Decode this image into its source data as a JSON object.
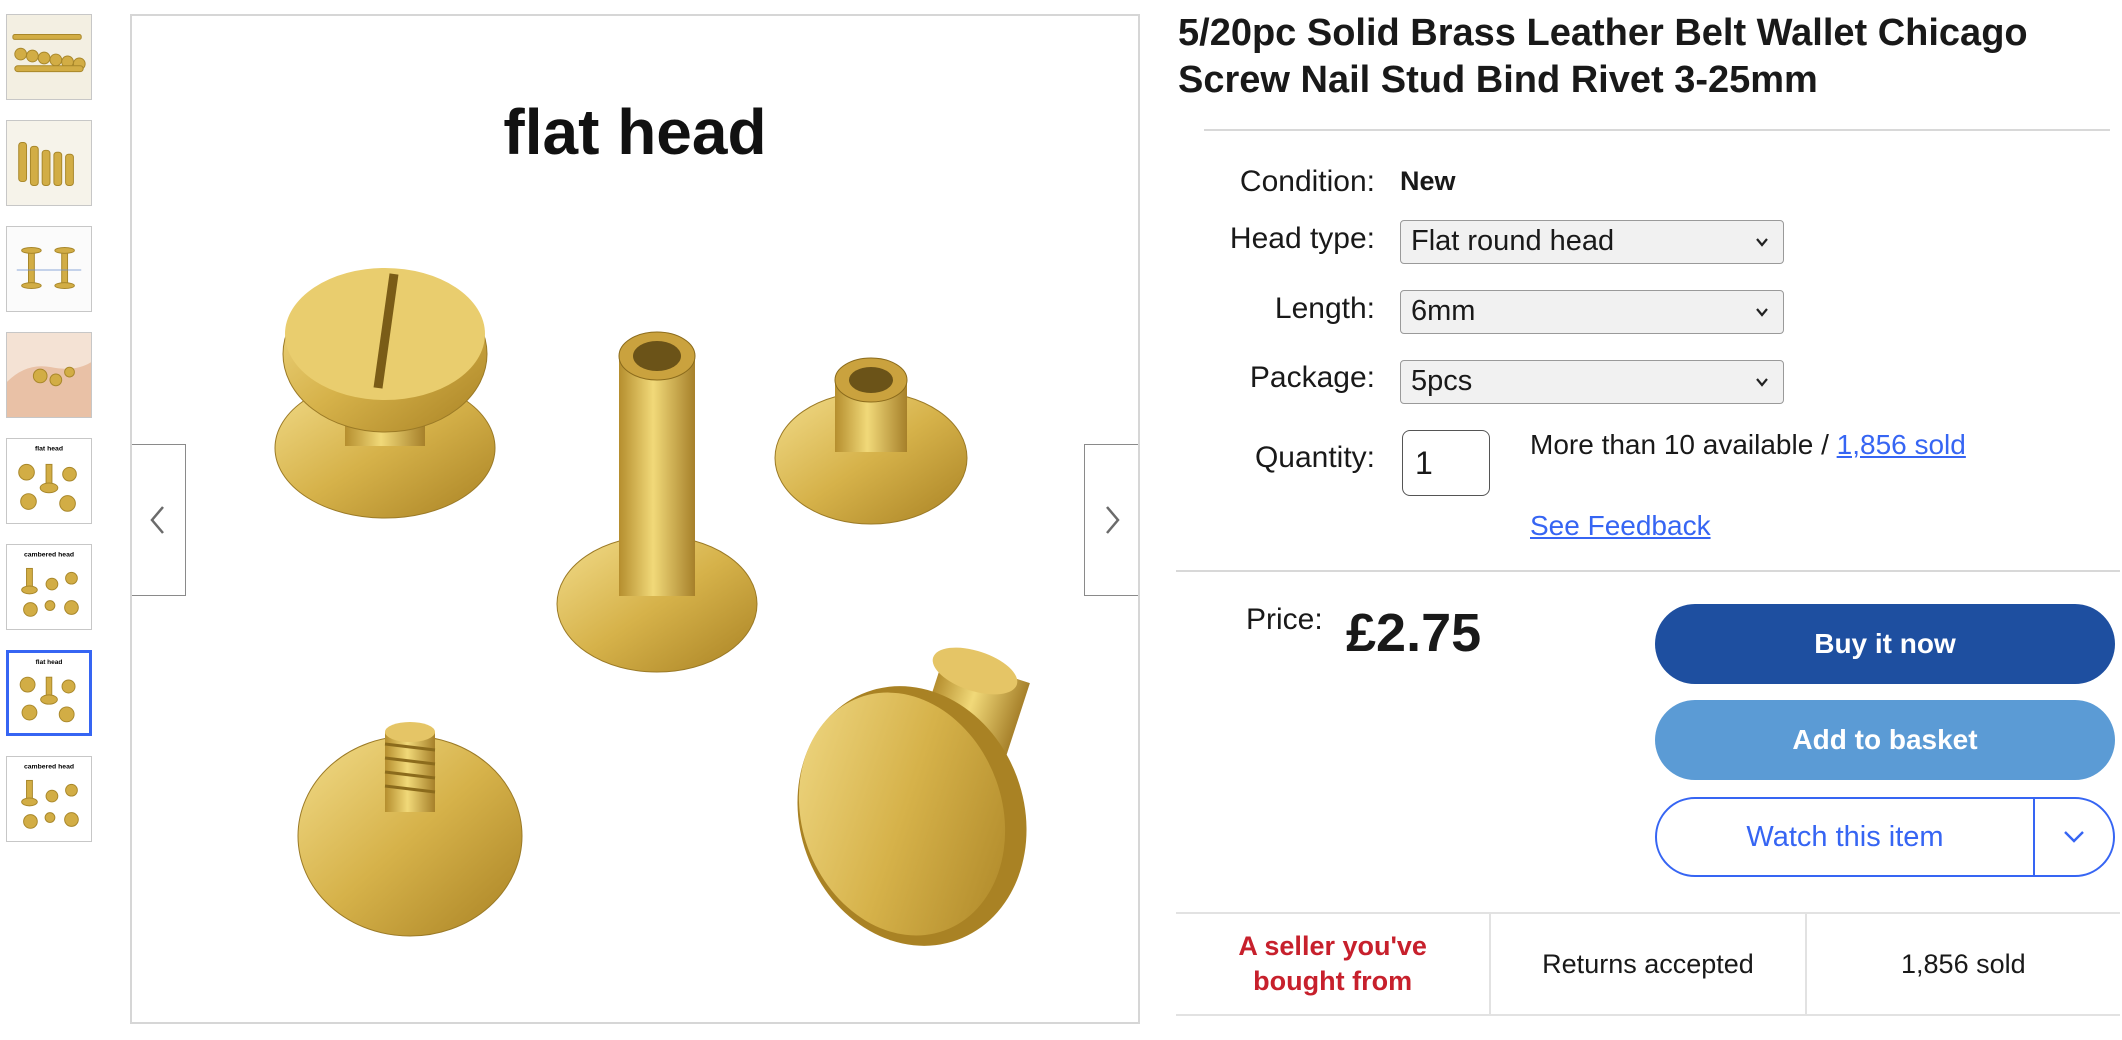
{
  "gallery": {
    "thumbnails": [
      {
        "caption": ""
      },
      {
        "caption": ""
      },
      {
        "caption": ""
      },
      {
        "caption": ""
      },
      {
        "caption": "flat head"
      },
      {
        "caption": "cambered head"
      },
      {
        "caption": "flat head"
      },
      {
        "caption": "cambered head"
      }
    ],
    "selected_index": 6,
    "main_image_caption": "flat head",
    "prev_icon": "chevron-left-icon",
    "next_icon": "chevron-right-icon"
  },
  "listing": {
    "title": "5/20pc Solid Brass Leather Belt Wallet Chicago Screw Nail Stud Bind Rivet 3-25mm",
    "condition_label": "Condition:",
    "condition_value": "New",
    "options": [
      {
        "label": "Head type:",
        "selected": "Flat round head"
      },
      {
        "label": "Length:",
        "selected": "6mm"
      },
      {
        "label": "Package:",
        "selected": "5pcs"
      }
    ],
    "quantity_label": "Quantity:",
    "quantity_value": "1",
    "availability_text": "More than 10 available / ",
    "sold_link": "1,856 sold",
    "feedback_link": "See Feedback",
    "price_label": "Price:",
    "price": "£2.75"
  },
  "actions": {
    "buy_now": "Buy it now",
    "add_to_basket": "Add to basket",
    "watch": "Watch this item",
    "watch_more_icon": "chevron-down-icon"
  },
  "badges": {
    "seller": "A seller you've bought from",
    "returns": "Returns accepted",
    "sold": "1,856 sold"
  },
  "colors": {
    "primary_blue": "#1e4fa0",
    "secondary_blue": "#5b9bd5",
    "link_blue": "#3665f3",
    "badge_red": "#c7202c",
    "brass": "#d4b14a"
  }
}
